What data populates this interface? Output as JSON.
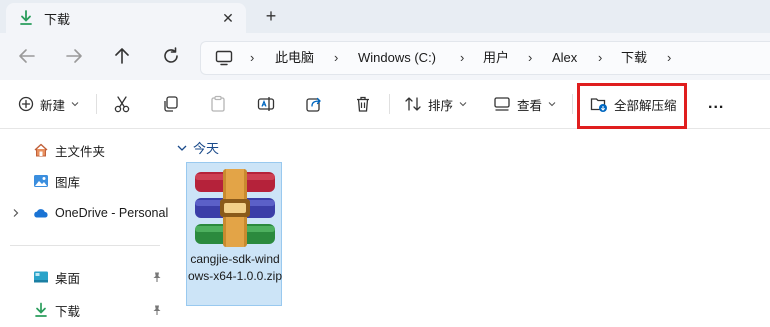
{
  "tab": {
    "title": "下载",
    "close": "✕",
    "new_tab": "+"
  },
  "breadcrumb": [
    "此电脑",
    "Windows (C:)",
    "用户",
    "Alex",
    "下载"
  ],
  "toolbar": {
    "new_label": "新建",
    "sort_label": "排序",
    "view_label": "查看",
    "extract_all_label": "全部解压缩",
    "more_label": "..."
  },
  "sidebar": {
    "items": [
      {
        "label": "主文件夹",
        "icon": "home-icon"
      },
      {
        "label": "图库",
        "icon": "gallery-icon"
      },
      {
        "label": "OneDrive - Personal",
        "icon": "onedrive-icon"
      },
      {
        "label": "桌面",
        "icon": "desktop-icon"
      },
      {
        "label": "下载",
        "icon": "download-icon"
      }
    ]
  },
  "content": {
    "group_label": "今天",
    "files": [
      {
        "name": "cangjie-sdk-windows-x64-1.0.0.zip",
        "icon": "winrar-archive-icon"
      }
    ]
  },
  "colors": {
    "highlight_border": "#e01e1e",
    "selection_bg": "#cce4f7",
    "accent": "#0067c0"
  }
}
